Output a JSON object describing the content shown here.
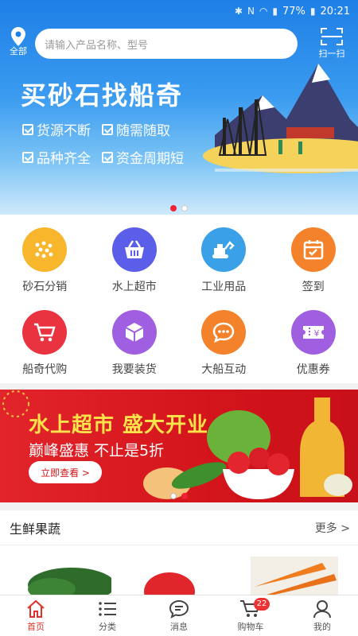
{
  "status_bar": {
    "battery": "77%",
    "time": "20:21"
  },
  "header": {
    "location_label": "全部",
    "search_placeholder": "请输入产品名称、型号",
    "scan_label": "扫一扫"
  },
  "hero": {
    "title": "买砂石找船奇",
    "features": [
      "货源不断",
      "随需随取",
      "品种齐全",
      "资金周期短"
    ]
  },
  "grid": {
    "items": [
      {
        "label": "砂石分销",
        "icon": "sand-dots-icon",
        "color": "#f8b62d"
      },
      {
        "label": "水上超市",
        "icon": "basket-icon",
        "color": "#5a5ee8"
      },
      {
        "label": "工业用品",
        "icon": "excavator-icon",
        "color": "#3aa0e8"
      },
      {
        "label": "签到",
        "icon": "calendar-check-icon",
        "color": "#f4822a"
      },
      {
        "label": "船奇代购",
        "icon": "cart-icon",
        "color": "#ea3340"
      },
      {
        "label": "我要装货",
        "icon": "box-icon",
        "color": "#a05ee0"
      },
      {
        "label": "大船互动",
        "icon": "chat-icon",
        "color": "#f4822a"
      },
      {
        "label": "优惠券",
        "icon": "coupon-icon",
        "color": "#a05ee0"
      }
    ]
  },
  "promo": {
    "title": "水上超市 盛大开业",
    "subtitle": "巅峰盛惠 不止是5折",
    "button": "立即查看 >"
  },
  "section": {
    "title": "生鲜果蔬",
    "more": "更多 >"
  },
  "bottom_nav": {
    "items": [
      {
        "label": "首页",
        "icon": "home-icon"
      },
      {
        "label": "分类",
        "icon": "list-icon"
      },
      {
        "label": "消息",
        "icon": "message-icon"
      },
      {
        "label": "购物车",
        "icon": "cart-icon",
        "badge": "22"
      },
      {
        "label": "我的",
        "icon": "user-icon"
      }
    ]
  },
  "colors": {
    "accent": "#e0322b",
    "brand_blue": "#1e7fe6"
  }
}
